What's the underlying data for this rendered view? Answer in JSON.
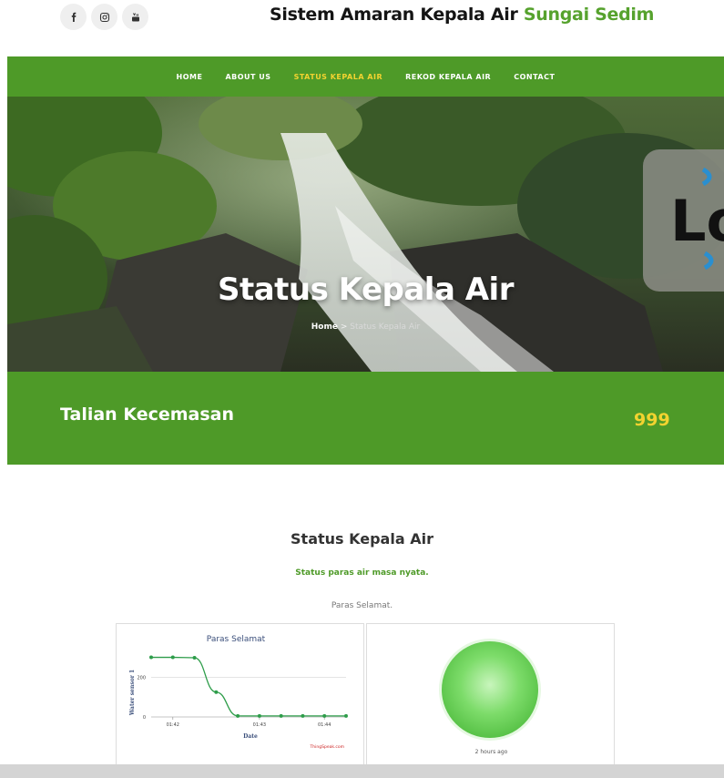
{
  "header": {
    "title_main": "Sistem Amaran Kepala Air",
    "title_highlight": "Sungai Sedim",
    "social": [
      "facebook-icon",
      "instagram-icon",
      "youtube-icon"
    ]
  },
  "nav": {
    "items": [
      {
        "label": "HOME"
      },
      {
        "label": "ABOUT US"
      },
      {
        "label": "STATUS KEPALA AIR"
      },
      {
        "label": "REKOD KEPALA AIR"
      },
      {
        "label": "CONTACT"
      }
    ],
    "active_index": 2
  },
  "hero": {
    "title": "Status Kepala Air",
    "breadcrumb_home": "Home",
    "breadcrumb_sep": ">",
    "breadcrumb_current": "Status Kepala Air"
  },
  "emergency": {
    "label": "Talian Kecemasan",
    "number": "999"
  },
  "status": {
    "title": "Status Kepala Air",
    "subtitle": "Status paras air masa nyata.",
    "note": "Paras Selamat.",
    "lamp_time": "2 hours ago"
  },
  "colors": {
    "brand_green": "#4e9a28",
    "accent_yellow": "#f2d330",
    "line_green": "#2e9d4a",
    "lamp_green": "#7ddc6a"
  },
  "chart_data": {
    "type": "line",
    "title": "Paras Selamat",
    "xlabel": "Date",
    "ylabel": "Water sensor 1",
    "credit": "ThingSpeak.com",
    "x_ticks": [
      "01:42",
      "01:43",
      "01:44"
    ],
    "y_ticks": [
      0,
      200
    ],
    "ylim": [
      0,
      330
    ],
    "x": [
      0,
      1,
      2,
      3,
      4,
      5,
      6,
      7,
      8,
      9
    ],
    "series": [
      {
        "values": [
          300,
          300,
          298,
          125,
          5,
          5,
          5,
          5,
          5,
          5
        ]
      }
    ],
    "grid": true
  }
}
